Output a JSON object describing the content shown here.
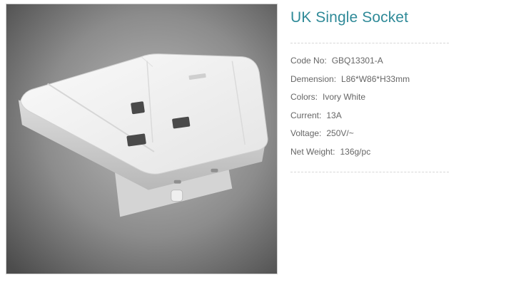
{
  "product": {
    "title": "UK Single Socket",
    "image_alt": "white UK single socket product photo",
    "specs": [
      {
        "label": "Code No:",
        "value": "GBQ13301-A"
      },
      {
        "label": "Demension:",
        "value": "L86*W86*H33mm"
      },
      {
        "label": "Colors:",
        "value": "Ivory White"
      },
      {
        "label": "Current:",
        "value": "13A"
      },
      {
        "label": "Voltage:",
        "value": "250V/~"
      },
      {
        "label": "Net Weight:",
        "value": "136g/pc"
      }
    ]
  },
  "colors": {
    "title": "#2f8a98",
    "spec_text": "#666666",
    "divider": "#d7d7d7"
  }
}
